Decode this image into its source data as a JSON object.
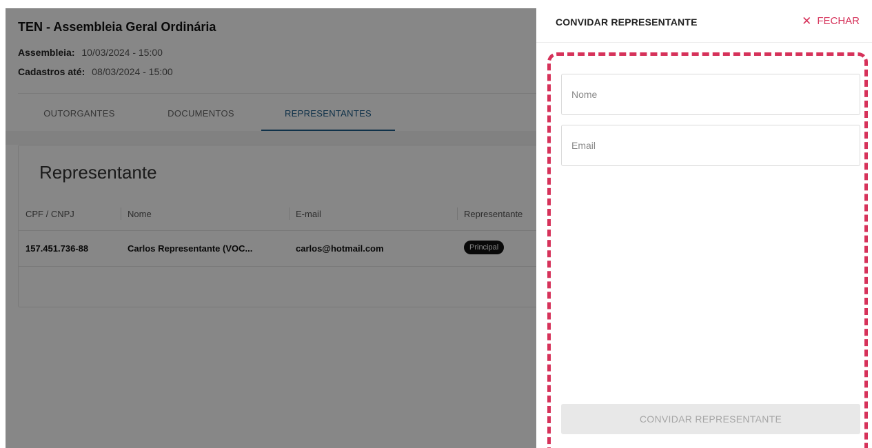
{
  "page": {
    "title": "TEN - Assembleia Geral Ordinária",
    "assembly_label": "Assembleia:",
    "assembly_value": "10/03/2024 - 15:00",
    "registration_label": "Cadastros até:",
    "registration_value": "08/03/2024 - 15:00",
    "tabs": [
      {
        "label": "OUTORGANTES",
        "active": false
      },
      {
        "label": "DOCUMENTOS",
        "active": false
      },
      {
        "label": "REPRESENTANTES",
        "active": true
      }
    ]
  },
  "card": {
    "title": "Representante",
    "columns": [
      "CPF / CNPJ",
      "Nome",
      "E-mail",
      "Representante"
    ],
    "rows": [
      {
        "cpf": "157.451.736-88",
        "name": "Carlos Representante (VOC...",
        "email": "carlos@hotmail.com",
        "type": "Principal"
      }
    ]
  },
  "panel": {
    "title": "CONVIDAR REPRESENTANTE",
    "close_label": "FECHAR",
    "close_icon": "close-icon",
    "name_placeholder": "Nome",
    "email_placeholder": "Email",
    "submit_label": "CONVIDAR REPRESENTANTE"
  },
  "colors": {
    "accent": "#d6325a",
    "active_tab": "#1d5e8a",
    "badge": "#111111"
  }
}
